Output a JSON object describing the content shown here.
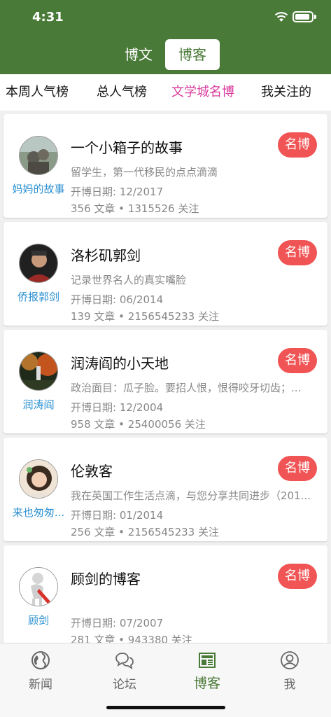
{
  "status": {
    "time": "4:31"
  },
  "header": {
    "segments": [
      "博文",
      "博客"
    ],
    "active_segment": "博客"
  },
  "tabs": [
    {
      "label": "本周人气榜"
    },
    {
      "label": "总人气榜"
    },
    {
      "label": "文学城名博",
      "active": true
    },
    {
      "label": "我关注的"
    }
  ],
  "colors": {
    "brand": "#4a7a37",
    "active_tab": "#d93a9c",
    "badge": "#f05454",
    "owner": "#2a8fd1"
  },
  "cards": [
    {
      "owner": "妈妈的故事",
      "title": "一个小箱子的故事",
      "badge": "名博",
      "desc": "留学生，第一代移民的点点滴滴",
      "date": "开博日期: 12/2017",
      "stats": "356 文章 • 1315526 关注"
    },
    {
      "owner": "侨报郭剑",
      "title": "洛杉矶郭剑",
      "badge": "名博",
      "desc": "记录世界名人的真实嘴脸",
      "date": "开博日期: 06/2014",
      "stats": "139 文章 • 2156545233 关注"
    },
    {
      "owner": "润涛阎",
      "title": "润涛阎的小天地",
      "badge": "名博",
      "desc": "政治面目：瓜子脸。要招人恨，恨得咬牙切齿；...",
      "date": "开博日期: 12/2004",
      "stats": "958 文章 • 25400056 关注"
    },
    {
      "owner": "来也匆匆...",
      "title": "伦敦客",
      "badge": "名博",
      "desc": "我在英国工作生活点滴，与您分享共同进步（201...",
      "date": "开博日期: 01/2014",
      "stats": "256 文章 • 2156545233 关注"
    },
    {
      "owner": "顾剑",
      "title": "顾剑的博客",
      "badge": "名博",
      "desc": "",
      "date": "开博日期: 07/2007",
      "stats": "281 文章 • 943380 关注"
    }
  ],
  "tabbar": [
    {
      "label": "新闻",
      "icon": "globe-icon"
    },
    {
      "label": "论坛",
      "icon": "chat-bubbles-icon"
    },
    {
      "label": "博客",
      "icon": "newspaper-icon",
      "active": true
    },
    {
      "label": "我",
      "icon": "person-icon"
    }
  ]
}
